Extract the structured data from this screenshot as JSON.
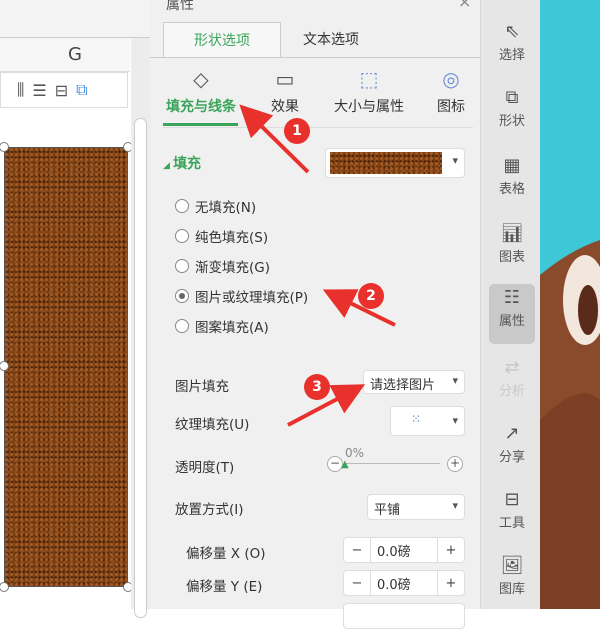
{
  "sheet": {
    "column_letter": "G"
  },
  "panel": {
    "title": "属性",
    "close": "×",
    "tabs": [
      {
        "label": "形状选项",
        "active": true
      },
      {
        "label": "文本选项",
        "active": false
      }
    ],
    "subtabs": [
      {
        "label": "填充与线条",
        "icon": "fill-line-icon",
        "active": true
      },
      {
        "label": "效果",
        "icon": "effect-icon"
      },
      {
        "label": "大小与属性",
        "icon": "size-icon"
      },
      {
        "label": "图标",
        "icon": "shape-icon"
      }
    ],
    "fill_section": "填充",
    "fill_options": [
      {
        "label": "无填充(N)",
        "checked": false
      },
      {
        "label": "纯色填充(S)",
        "checked": false
      },
      {
        "label": "渐变填充(G)",
        "checked": false
      },
      {
        "label": "图片或纹理填充(P)",
        "checked": true
      },
      {
        "label": "图案填充(A)",
        "checked": false
      }
    ],
    "picture_fill": {
      "label": "图片填充",
      "value": "请选择图片"
    },
    "texture_fill": {
      "label": "纹理填充(U)"
    },
    "transparency": {
      "label": "透明度(T)",
      "value": "0%",
      "percent": 0,
      "minus": "−",
      "plus": "+"
    },
    "placement": {
      "label": "放置方式(I)",
      "value": "平铺"
    },
    "offset_x": {
      "label": "偏移量 X (O)",
      "value": "0.0磅",
      "minus": "−",
      "plus": "+"
    },
    "offset_y": {
      "label": "偏移量 Y (E)",
      "value": "0.0磅",
      "minus": "−",
      "plus": "+"
    }
  },
  "sidebar": [
    {
      "label": "选择",
      "icon": "cursor-icon"
    },
    {
      "label": "形状",
      "icon": "shapes-icon"
    },
    {
      "label": "表格",
      "icon": "table-icon"
    },
    {
      "label": "图表",
      "icon": "chart-icon"
    },
    {
      "label": "属性",
      "icon": "properties-icon",
      "active": true
    },
    {
      "label": "分析",
      "icon": "analyze-icon",
      "disabled": true
    },
    {
      "label": "分享",
      "icon": "share-icon"
    },
    {
      "label": "工具",
      "icon": "toolbox-icon"
    },
    {
      "label": "图库",
      "icon": "gallery-icon"
    }
  ],
  "annotations": [
    "1",
    "2",
    "3"
  ],
  "colors": {
    "accent": "#3aa55a",
    "annotation": "#e8302c"
  }
}
